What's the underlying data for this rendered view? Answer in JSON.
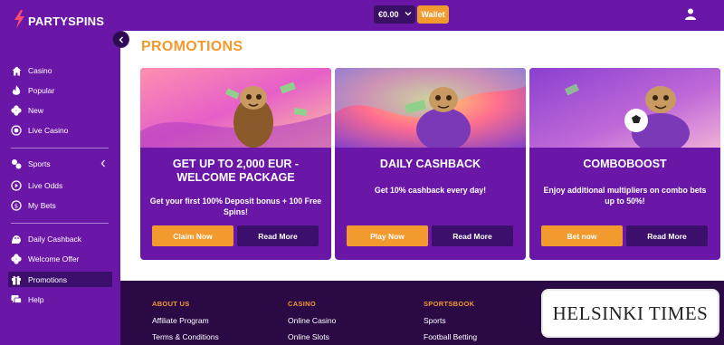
{
  "header": {
    "logo_text": "PARTYSPINS",
    "balance": "€0.00",
    "wallet_label": "Wallet"
  },
  "sidebar": {
    "items": [
      {
        "label": "Casino",
        "icon": "home-icon"
      },
      {
        "label": "Popular",
        "icon": "flame-icon"
      },
      {
        "label": "New",
        "icon": "clover-icon"
      },
      {
        "label": "Live Casino",
        "icon": "live-dot-icon"
      },
      {
        "label": "Sports",
        "icon": "sports-icon"
      },
      {
        "label": "Live Odds",
        "icon": "play-circle-icon"
      },
      {
        "label": "My Bets",
        "icon": "coin-icon"
      },
      {
        "label": "Daily Cashback",
        "icon": "sloth-icon"
      },
      {
        "label": "Welcome Offer",
        "icon": "clover-icon"
      },
      {
        "label": "Promotions",
        "icon": "gift-icon"
      },
      {
        "label": "Help",
        "icon": "help-chat-icon"
      }
    ],
    "active": "Promotions"
  },
  "main": {
    "title": "PROMOTIONS",
    "cards": [
      {
        "title": "GET UP TO 2,000 EUR - WELCOME PACKAGE",
        "description": "Get your first 100% Deposit bonus + 100 Free Spins!",
        "primary": "Claim Now",
        "secondary": "Read More"
      },
      {
        "title": "DAILY CASHBACK",
        "description": "Get 10% cashback every day!",
        "primary": "Play Now",
        "secondary": "Read More"
      },
      {
        "title": "COMBOBOOST",
        "description": "Enjoy additional multipliers on combo bets up to 50%!",
        "primary": "Bet now",
        "secondary": "Read More"
      }
    ]
  },
  "footer": {
    "columns": [
      {
        "heading": "ABOUT US",
        "links": [
          "Affiliate Program",
          "Terms & Conditions"
        ]
      },
      {
        "heading": "CASINO",
        "links": [
          "Online Casino",
          "Online Slots"
        ]
      },
      {
        "heading": "SPORTSBOOK",
        "links": [
          "Sports",
          "Football Betting"
        ]
      }
    ]
  },
  "watermark": "HELSINKI TIMES",
  "colors": {
    "brand_purple": "#6a17a8",
    "dark_purple": "#3c0f6c",
    "accent_orange": "#f29a2e",
    "footer_bg": "#2a0945"
  }
}
